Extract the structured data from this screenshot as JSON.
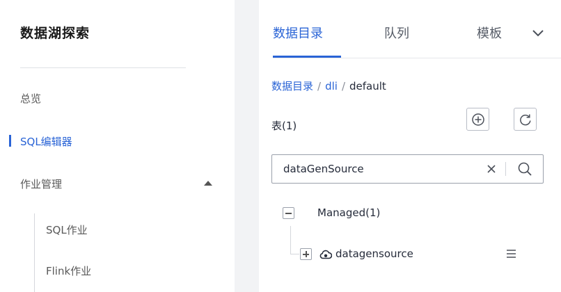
{
  "sidebar": {
    "title": "数据湖探索",
    "items": {
      "overview": "总览",
      "sql_editor": "SQL编辑器",
      "job_management": "作业管理"
    },
    "sub_items": {
      "sql_job": "SQL作业",
      "flink_job": "Flink作业"
    }
  },
  "panel": {
    "tabs": [
      "数据目录",
      "队列",
      "模板"
    ],
    "active_tab": "数据目录",
    "breadcrumb": {
      "root": "数据目录",
      "catalog": "dli",
      "database": "default",
      "separator": "/"
    },
    "table_count_label": "表(1)",
    "search": {
      "value": "dataGenSource"
    },
    "tree": {
      "group_label": "Managed(1)",
      "table_name": "datagensource"
    }
  },
  "colors": {
    "accent": "#2a64d6",
    "text": "#252b3a",
    "muted": "#595959"
  },
  "icons": [
    "caret-up-icon",
    "chevron-down-icon",
    "add-icon",
    "refresh-icon",
    "clear-icon",
    "search-icon",
    "collapse-icon",
    "expand-icon",
    "cloud-table-icon",
    "menu-icon"
  ]
}
